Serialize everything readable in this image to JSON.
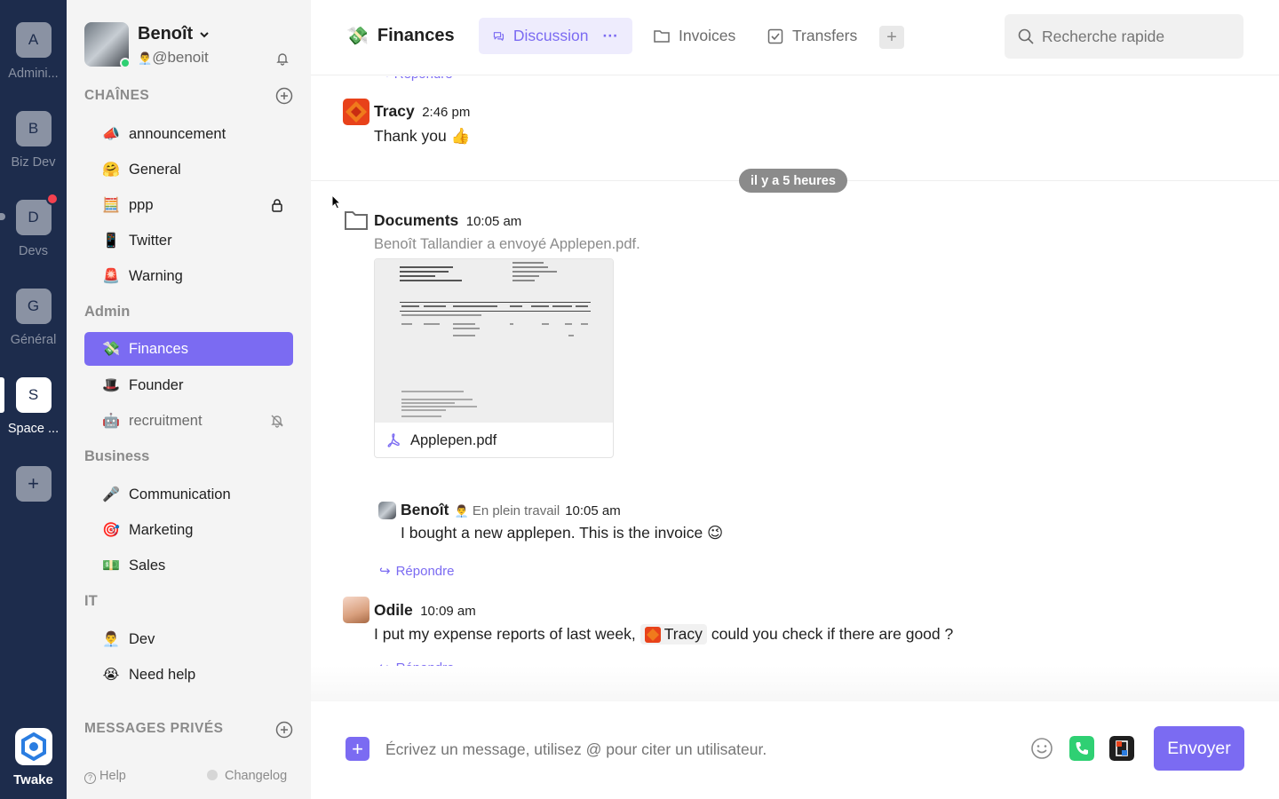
{
  "workspaces": [
    {
      "initial": "A",
      "label": "Admini..."
    },
    {
      "initial": "B",
      "label": "Biz Dev"
    },
    {
      "initial": "D",
      "label": "Devs"
    },
    {
      "initial": "G",
      "label": "Général"
    },
    {
      "initial": "S",
      "label": "Space ..."
    }
  ],
  "workspace_add": "+",
  "brand": "Twake",
  "user": {
    "name": "Benoît",
    "handle": "@benoit",
    "handle_emoji": "👨‍💼"
  },
  "sections": {
    "channels": "CHAÎNES",
    "admin": "Admin",
    "business": "Business",
    "it": "IT",
    "private": "MESSAGES PRIVÉS"
  },
  "channels": [
    {
      "emoji": "📣",
      "name": "announcement"
    },
    {
      "emoji": "🤗",
      "name": "General"
    },
    {
      "emoji": "🧮",
      "name": "ppp"
    },
    {
      "emoji": "📱",
      "name": "Twitter"
    },
    {
      "emoji": "🚨",
      "name": "Warning"
    }
  ],
  "admin_channels": [
    {
      "emoji": "💸",
      "name": "Finances"
    },
    {
      "emoji": "🎩",
      "name": "Founder"
    },
    {
      "emoji": "🤖",
      "name": "recruitment"
    }
  ],
  "business_channels": [
    {
      "emoji": "🎤",
      "name": "Communication"
    },
    {
      "emoji": "🎯",
      "name": "Marketing"
    },
    {
      "emoji": "💵",
      "name": "Sales"
    }
  ],
  "it_channels": [
    {
      "emoji": "👨‍💼",
      "name": "Dev"
    },
    {
      "emoji": "😭",
      "name": "Need help"
    }
  ],
  "footer": {
    "help": "Help",
    "changelog": "Changelog"
  },
  "header": {
    "channel_emoji": "💸",
    "channel_name": "Finances",
    "tabs": [
      "Discussion",
      "Invoices",
      "Transfers"
    ],
    "tab_more": "···",
    "tab_add": "+",
    "search_placeholder": "Recherche rapide"
  },
  "messages": {
    "reply_label": "Répondre",
    "tracy": {
      "author": "Tracy",
      "time": "2:46 pm",
      "text": "Thank you 👍"
    },
    "divider": "il y a 5 heures",
    "documents": {
      "author": "Documents",
      "time": "10:05 am",
      "text": "Benoît Tallandier a envoyé Applepen.pdf.",
      "file_name": "Applepen.pdf"
    },
    "benoit": {
      "author": "Benoît",
      "status_emoji": "👨‍💼",
      "status": "En plein travail",
      "time": "10:05 am",
      "text": "I bought a new applepen. This is the invoice 😉"
    },
    "odile": {
      "author": "Odile",
      "time": "10:09 am",
      "text_before": "I put my expense reports of last week,",
      "mention": "Tracy",
      "text_after": "could you check if there are good ?"
    }
  },
  "composer": {
    "placeholder": "Écrivez un message, utilisez @ pour citer un utilisateur.",
    "add": "+",
    "send": "Envoyer"
  },
  "colors": {
    "accent": "#7b6bf2",
    "rail": "#1d2c4c",
    "sidebar": "#f4f4f4",
    "badge": "#f4414f",
    "online": "#2fd073"
  }
}
